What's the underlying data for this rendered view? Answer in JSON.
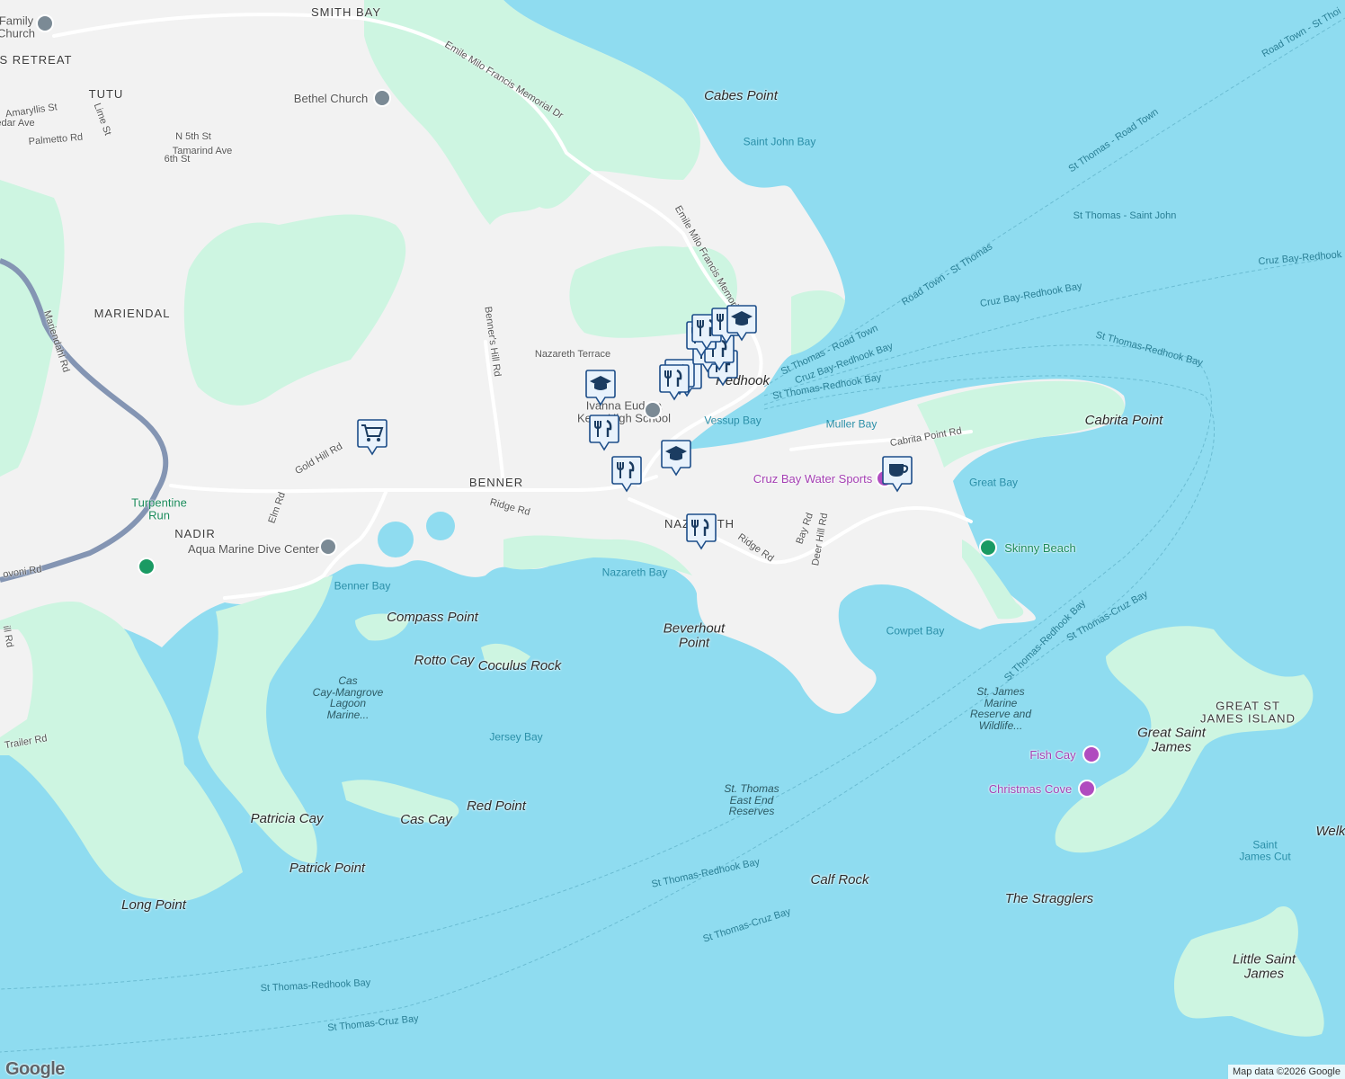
{
  "map": {
    "colors": {
      "water": "#8fdcf0",
      "land": "#f2f2f2",
      "park": "#cdf5e1",
      "road": "#ffffff",
      "highway": "#8495b3",
      "marker_fill": "#e8f2fc",
      "marker_stroke": "#1d4e89",
      "icon": "#1b3c61"
    },
    "places": [
      {
        "text": "SMITH BAY",
        "style": "place-caps"
      },
      {
        "text": "TUTU",
        "style": "place-caps"
      },
      {
        "text": "MARIENDAL",
        "style": "place-caps"
      },
      {
        "text": "NADIR",
        "style": "place-caps"
      },
      {
        "text": "BENNER",
        "style": "place-caps"
      },
      {
        "text": "NAZARETH",
        "style": "place-caps"
      },
      {
        "text": "S RETREAT",
        "style": "place-caps"
      },
      {
        "text": "GREAT ST\nJAMES ISLAND",
        "style": "place-caps"
      },
      {
        "text": "Cabes Point",
        "style": "place-bold"
      },
      {
        "text": "Cabrita Point",
        "style": "place-bold"
      },
      {
        "text": "Compass Point",
        "style": "place-bold"
      },
      {
        "text": "Rotto Cay",
        "style": "place-bold"
      },
      {
        "text": "Coculus Rock",
        "style": "place-bold"
      },
      {
        "text": "Beverhout\nPoint",
        "style": "place-bold"
      },
      {
        "text": "Red Point",
        "style": "place-bold"
      },
      {
        "text": "Cas Cay",
        "style": "place-bold"
      },
      {
        "text": "Patricia Cay",
        "style": "place-bold"
      },
      {
        "text": "Patrick Point",
        "style": "place-bold"
      },
      {
        "text": "Long Point",
        "style": "place-bold"
      },
      {
        "text": "Calf Rock",
        "style": "place-bold"
      },
      {
        "text": "The Stragglers",
        "style": "place-bold"
      },
      {
        "text": "Great Saint\nJames",
        "style": "place-bold"
      },
      {
        "text": "Little Saint\nJames",
        "style": "place-bold"
      },
      {
        "text": "Welk",
        "style": "place-bold"
      },
      {
        "text": "Redhook",
        "style": "place-bold"
      }
    ],
    "waters": [
      {
        "text": "Saint John Bay"
      },
      {
        "text": "Vessup Bay"
      },
      {
        "text": "Muller Bay"
      },
      {
        "text": "Great Bay"
      },
      {
        "text": "Nazareth Bay"
      },
      {
        "text": "Benner Bay"
      },
      {
        "text": "Cowpet Bay"
      },
      {
        "text": "Jersey Bay"
      },
      {
        "text": "Saint\nJames Cut"
      }
    ],
    "reserves": [
      {
        "text": "Cas\nCay-Mangrove\nLagoon\nMarine..."
      },
      {
        "text": "St. James\nMarine\nReserve and\nWildlife..."
      },
      {
        "text": "St. Thomas\nEast End\nReserves"
      }
    ],
    "roads": [
      {
        "text": "Emile Milo Francis Memorial Dr"
      },
      {
        "text": "Emile Milo Francis Memorial"
      },
      {
        "text": "Nazareth Terrace"
      },
      {
        "text": "Benner's Hill Rd"
      },
      {
        "text": "Gold Hill Rd"
      },
      {
        "text": "Elm Rd"
      },
      {
        "text": "Ridge Rd"
      },
      {
        "text": "Ridge Rd"
      },
      {
        "text": "Bay Rd"
      },
      {
        "text": "Deer Hill Rd"
      },
      {
        "text": "Cabrita Point Rd"
      },
      {
        "text": "Mariendahl Rd"
      },
      {
        "text": "Amaryllis St"
      },
      {
        "text": "edar Ave"
      },
      {
        "text": "Palmetto Rd"
      },
      {
        "text": "Lime St"
      },
      {
        "text": "N 5th St"
      },
      {
        "text": "Tamarind Ave"
      },
      {
        "text": "6th St"
      },
      {
        "text": "ovoni Rd"
      },
      {
        "text": "Trailer Rd"
      },
      {
        "text": "ill Rd"
      }
    ],
    "ferries": [
      {
        "text": "Road Town - St Thoi"
      },
      {
        "text": "St Thomas - Road Town"
      },
      {
        "text": "St Thomas - Saint John"
      },
      {
        "text": "Road Town - St Thomas"
      },
      {
        "text": "Cruz Bay-Redhook Bay"
      },
      {
        "text": "Cruz Bay-Redhook"
      },
      {
        "text": "St Thomas-Redhook Bay"
      },
      {
        "text": "St Thomas - Road Town"
      },
      {
        "text": "Cruz Bay-Redhook Bay"
      },
      {
        "text": "St Thomas-Redhook Bay"
      },
      {
        "text": "St Thomas-Redhook Bay"
      },
      {
        "text": "St Thomas-Cruz Bay"
      },
      {
        "text": "St Thomas-Redhook Bay"
      },
      {
        "text": "St Thomas-Cruz Bay"
      },
      {
        "text": "St Thomas-Redhook Bay"
      },
      {
        "text": "St Thomas-Cruz Bay"
      }
    ],
    "pois": [
      {
        "text": "Bethel Church",
        "style": "poi-grey",
        "icon": "church-icon"
      },
      {
        "text": "Family\nChurch",
        "style": "poi-grey",
        "icon": "church-icon"
      },
      {
        "text": "Ivanna Eudora\nKean High School",
        "style": "poi-grey",
        "icon": "school-icon"
      },
      {
        "text": "Aqua Marine Dive Center",
        "style": "poi-grey",
        "icon": "dive-icon"
      },
      {
        "text": "Turpentine\nRun",
        "style": "poi-green",
        "icon": "park-icon"
      },
      {
        "text": "Skinny Beach",
        "style": "poi-green",
        "icon": "tree-icon"
      },
      {
        "text": "Cruz Bay Water Sports",
        "style": "poi-purple",
        "icon": "camera-icon"
      },
      {
        "text": "Fish Cay",
        "style": "poi-purple",
        "icon": "camera-icon"
      },
      {
        "text": "Christmas Cove",
        "style": "poi-purple",
        "icon": "camera-icon"
      }
    ],
    "markers": [
      {
        "type": "restaurant"
      },
      {
        "type": "restaurant"
      },
      {
        "type": "restaurant"
      },
      {
        "type": "restaurant"
      },
      {
        "type": "restaurant"
      },
      {
        "type": "restaurant"
      },
      {
        "type": "restaurant"
      },
      {
        "type": "restaurant"
      },
      {
        "type": "restaurant"
      },
      {
        "type": "restaurant"
      },
      {
        "type": "restaurant"
      },
      {
        "type": "restaurant"
      },
      {
        "type": "school"
      },
      {
        "type": "school"
      },
      {
        "type": "school"
      },
      {
        "type": "shopping"
      },
      {
        "type": "cafe"
      }
    ],
    "attribution": "Map data ©2026 Google",
    "logo": "Google"
  }
}
